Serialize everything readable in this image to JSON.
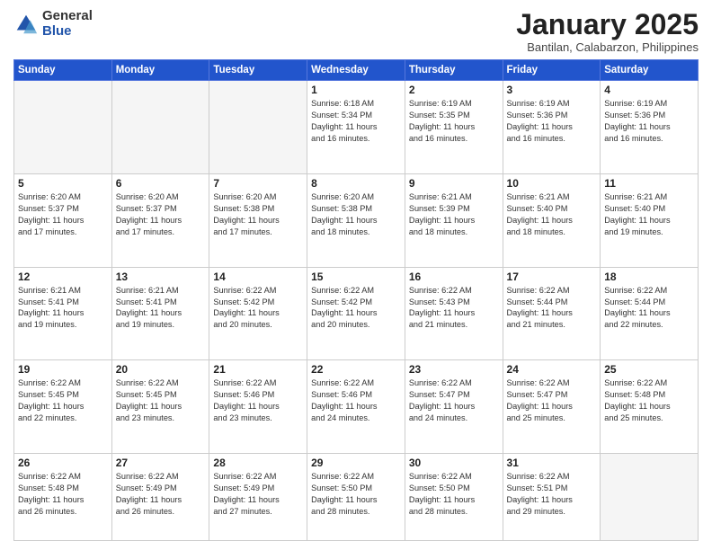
{
  "logo": {
    "general": "General",
    "blue": "Blue"
  },
  "header": {
    "title": "January 2025",
    "location": "Bantilan, Calabarzon, Philippines"
  },
  "days_of_week": [
    "Sunday",
    "Monday",
    "Tuesday",
    "Wednesday",
    "Thursday",
    "Friday",
    "Saturday"
  ],
  "weeks": [
    [
      {
        "day": "",
        "info": ""
      },
      {
        "day": "",
        "info": ""
      },
      {
        "day": "",
        "info": ""
      },
      {
        "day": "1",
        "info": "Sunrise: 6:18 AM\nSunset: 5:34 PM\nDaylight: 11 hours\nand 16 minutes."
      },
      {
        "day": "2",
        "info": "Sunrise: 6:19 AM\nSunset: 5:35 PM\nDaylight: 11 hours\nand 16 minutes."
      },
      {
        "day": "3",
        "info": "Sunrise: 6:19 AM\nSunset: 5:36 PM\nDaylight: 11 hours\nand 16 minutes."
      },
      {
        "day": "4",
        "info": "Sunrise: 6:19 AM\nSunset: 5:36 PM\nDaylight: 11 hours\nand 16 minutes."
      }
    ],
    [
      {
        "day": "5",
        "info": "Sunrise: 6:20 AM\nSunset: 5:37 PM\nDaylight: 11 hours\nand 17 minutes."
      },
      {
        "day": "6",
        "info": "Sunrise: 6:20 AM\nSunset: 5:37 PM\nDaylight: 11 hours\nand 17 minutes."
      },
      {
        "day": "7",
        "info": "Sunrise: 6:20 AM\nSunset: 5:38 PM\nDaylight: 11 hours\nand 17 minutes."
      },
      {
        "day": "8",
        "info": "Sunrise: 6:20 AM\nSunset: 5:38 PM\nDaylight: 11 hours\nand 18 minutes."
      },
      {
        "day": "9",
        "info": "Sunrise: 6:21 AM\nSunset: 5:39 PM\nDaylight: 11 hours\nand 18 minutes."
      },
      {
        "day": "10",
        "info": "Sunrise: 6:21 AM\nSunset: 5:40 PM\nDaylight: 11 hours\nand 18 minutes."
      },
      {
        "day": "11",
        "info": "Sunrise: 6:21 AM\nSunset: 5:40 PM\nDaylight: 11 hours\nand 19 minutes."
      }
    ],
    [
      {
        "day": "12",
        "info": "Sunrise: 6:21 AM\nSunset: 5:41 PM\nDaylight: 11 hours\nand 19 minutes."
      },
      {
        "day": "13",
        "info": "Sunrise: 6:21 AM\nSunset: 5:41 PM\nDaylight: 11 hours\nand 19 minutes."
      },
      {
        "day": "14",
        "info": "Sunrise: 6:22 AM\nSunset: 5:42 PM\nDaylight: 11 hours\nand 20 minutes."
      },
      {
        "day": "15",
        "info": "Sunrise: 6:22 AM\nSunset: 5:42 PM\nDaylight: 11 hours\nand 20 minutes."
      },
      {
        "day": "16",
        "info": "Sunrise: 6:22 AM\nSunset: 5:43 PM\nDaylight: 11 hours\nand 21 minutes."
      },
      {
        "day": "17",
        "info": "Sunrise: 6:22 AM\nSunset: 5:44 PM\nDaylight: 11 hours\nand 21 minutes."
      },
      {
        "day": "18",
        "info": "Sunrise: 6:22 AM\nSunset: 5:44 PM\nDaylight: 11 hours\nand 22 minutes."
      }
    ],
    [
      {
        "day": "19",
        "info": "Sunrise: 6:22 AM\nSunset: 5:45 PM\nDaylight: 11 hours\nand 22 minutes."
      },
      {
        "day": "20",
        "info": "Sunrise: 6:22 AM\nSunset: 5:45 PM\nDaylight: 11 hours\nand 23 minutes."
      },
      {
        "day": "21",
        "info": "Sunrise: 6:22 AM\nSunset: 5:46 PM\nDaylight: 11 hours\nand 23 minutes."
      },
      {
        "day": "22",
        "info": "Sunrise: 6:22 AM\nSunset: 5:46 PM\nDaylight: 11 hours\nand 24 minutes."
      },
      {
        "day": "23",
        "info": "Sunrise: 6:22 AM\nSunset: 5:47 PM\nDaylight: 11 hours\nand 24 minutes."
      },
      {
        "day": "24",
        "info": "Sunrise: 6:22 AM\nSunset: 5:47 PM\nDaylight: 11 hours\nand 25 minutes."
      },
      {
        "day": "25",
        "info": "Sunrise: 6:22 AM\nSunset: 5:48 PM\nDaylight: 11 hours\nand 25 minutes."
      }
    ],
    [
      {
        "day": "26",
        "info": "Sunrise: 6:22 AM\nSunset: 5:48 PM\nDaylight: 11 hours\nand 26 minutes."
      },
      {
        "day": "27",
        "info": "Sunrise: 6:22 AM\nSunset: 5:49 PM\nDaylight: 11 hours\nand 26 minutes."
      },
      {
        "day": "28",
        "info": "Sunrise: 6:22 AM\nSunset: 5:49 PM\nDaylight: 11 hours\nand 27 minutes."
      },
      {
        "day": "29",
        "info": "Sunrise: 6:22 AM\nSunset: 5:50 PM\nDaylight: 11 hours\nand 28 minutes."
      },
      {
        "day": "30",
        "info": "Sunrise: 6:22 AM\nSunset: 5:50 PM\nDaylight: 11 hours\nand 28 minutes."
      },
      {
        "day": "31",
        "info": "Sunrise: 6:22 AM\nSunset: 5:51 PM\nDaylight: 11 hours\nand 29 minutes."
      },
      {
        "day": "",
        "info": ""
      }
    ]
  ]
}
